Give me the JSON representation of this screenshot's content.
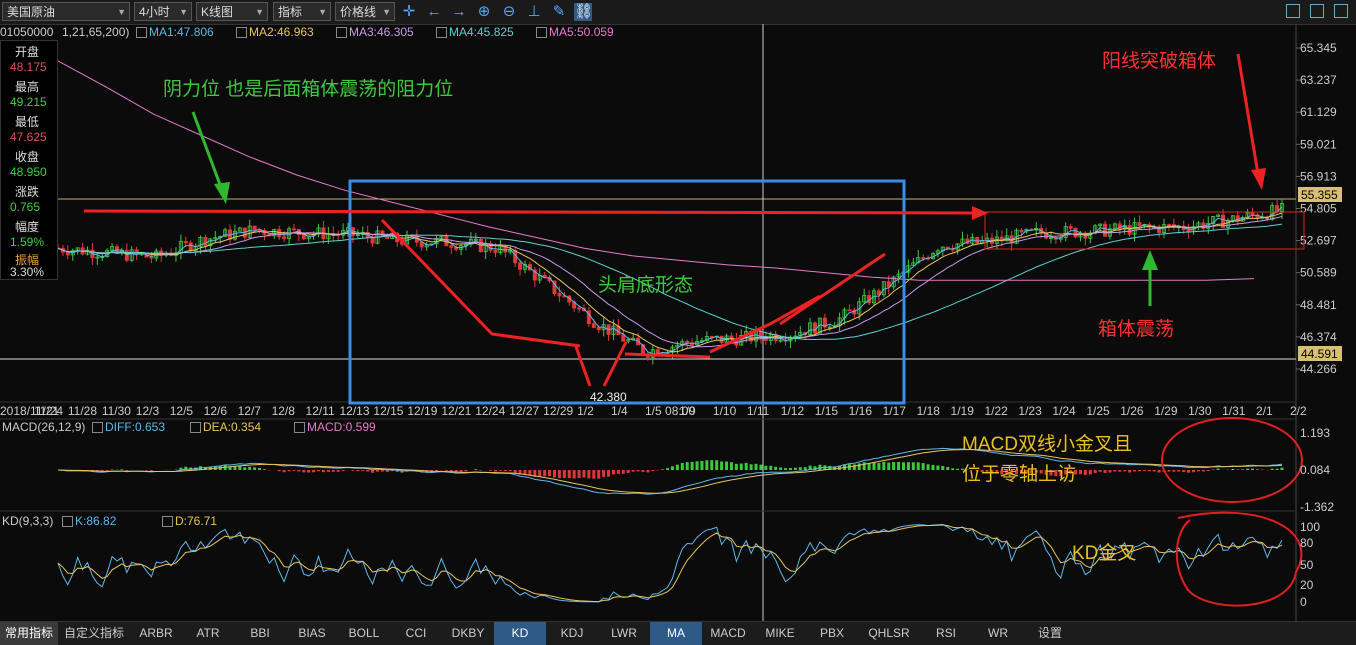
{
  "toolbar": {
    "instrument": "美国原油",
    "period": "4小时",
    "chart_type": "K线图",
    "indicator": "指标",
    "price_line": "价格线",
    "icons": [
      "crosshair-icon",
      "arrow-left-icon",
      "arrow-right-icon",
      "zoom-in-icon",
      "zoom-out-icon",
      "axis-icon",
      "pencil-icon",
      "link-icon"
    ]
  },
  "ohlc_panel": {
    "code": "01050000",
    "open_label": "开盘",
    "open": "48.175",
    "high_label": "最高",
    "high": "49.215",
    "low_label": "最低",
    "low": "47.625",
    "close_label": "收盘",
    "close": "48.950",
    "change_label": "涨跌",
    "change": "0.765",
    "pct_label": "幅度",
    "pct": "1.59%",
    "amp_label": "振幅",
    "amp": "3.30%"
  },
  "ma_legend": {
    "params": "1,21,65,200)",
    "items": [
      {
        "label": "MA1:47.806",
        "color": "#5fb8e8"
      },
      {
        "label": "MA2:46.963",
        "color": "#e8c45f"
      },
      {
        "label": "MA3:46.305",
        "color": "#c89be8"
      },
      {
        "label": "MA4:45.825",
        "color": "#5fd0d0"
      },
      {
        "label": "MA5:50.059",
        "color": "#e87ad0"
      }
    ]
  },
  "price_axis": {
    "ticks": [
      "65.345",
      "63.237",
      "61.129",
      "59.021",
      "56.913",
      "54.805",
      "52.697",
      "50.589",
      "48.481",
      "46.374",
      "44.266"
    ],
    "current_price": "55.355",
    "hline_price": "44.591"
  },
  "date_axis": {
    "labels": [
      "2018/11/21",
      "11/24",
      "11/28",
      "11/30",
      "12/3",
      "12/5",
      "12/6",
      "12/7",
      "12/8",
      "12/11",
      "12/13",
      "12/15",
      "12/19",
      "12/21",
      "12/24",
      "12/27",
      "12/29",
      "1/2",
      "1/4",
      "1/5 08:00",
      "1/9",
      "1/10",
      "1/11",
      "1/12",
      "1/15",
      "1/16",
      "1/17",
      "1/18",
      "1/19",
      "1/22",
      "1/23",
      "1/24",
      "1/25",
      "1/26",
      "1/29",
      "1/30",
      "1/31",
      "2/1",
      "2/2"
    ]
  },
  "macd_legend": {
    "title": "MACD(26,12,9)",
    "diff": "DIFF:0.653",
    "diff_color": "#5fb8e8",
    "dea": "DEA:0.354",
    "dea_color": "#e8c45f",
    "macd": "MACD:0.599",
    "macd_color": "#e87ad0",
    "axis": [
      "1.193",
      "0.084",
      "-1.362"
    ]
  },
  "kd_legend": {
    "title": "KD(9,3,3)",
    "k": "K:86.82",
    "k_color": "#5fb8e8",
    "d": "D:76.71",
    "d_color": "#e8c45f",
    "axis": [
      "100",
      "80",
      "50",
      "20",
      "0"
    ]
  },
  "annotations": {
    "resistance": "阴力位 也是后面箱体震荡的阻力位",
    "head_shoulders": "头肩底形态",
    "breakout": "阳线突破箱体",
    "box_oscillation": "箱体震荡",
    "macd_note_1": "MACD双线小金叉且",
    "macd_note_2": "位于零轴上访",
    "kd_note": "KD金叉",
    "low_label": "42.380"
  },
  "bottom_tabs": [
    "常用指标",
    "自定义指标",
    "ARBR",
    "ATR",
    "BBI",
    "BIAS",
    "BOLL",
    "CCI",
    "DKBY",
    "KD",
    "KDJ",
    "LWR",
    "MA",
    "MACD",
    "MIKE",
    "PBX",
    "QHLSR",
    "RSI",
    "WR",
    "设置"
  ],
  "active_tabs": [
    "KD",
    "MA"
  ],
  "chart_data": {
    "type": "line",
    "title": "",
    "xlabel": "",
    "ylabel": "",
    "ylim": [
      44.266,
      65.345
    ],
    "x": [
      "11/21",
      "11/24",
      "11/28",
      "11/30",
      "12/3",
      "12/5",
      "12/7",
      "12/11",
      "12/13",
      "12/15",
      "12/19",
      "12/21",
      "12/24",
      "12/27",
      "12/29",
      "1/2",
      "1/4",
      "1/9",
      "1/11",
      "1/15",
      "1/18",
      "1/22",
      "1/25",
      "1/29",
      "1/31",
      "2/2"
    ],
    "series": [
      {
        "name": "MA1",
        "values": [
          52.2,
          51.9,
          51.6,
          52.8,
          53.4,
          53.2,
          53.1,
          52.7,
          52.6,
          52.2,
          49.8,
          47.3,
          45.4,
          46.1,
          46.3,
          46.6,
          47.6,
          49.9,
          52.4,
          52.6,
          53.2,
          53.3,
          53.5,
          53.6,
          54.1,
          54.7
        ]
      },
      {
        "name": "MA5",
        "values": [
          64.5,
          62.8,
          61.0,
          59.6,
          58.2,
          57.0,
          56.0,
          55.2,
          54.4,
          53.6,
          52.9,
          52.2,
          51.7,
          51.4,
          51.1,
          50.9,
          50.6,
          50.3,
          50.1,
          50.1,
          50.1,
          50.1,
          50.1,
          50.1,
          50.1,
          50.2
        ]
      }
    ]
  }
}
